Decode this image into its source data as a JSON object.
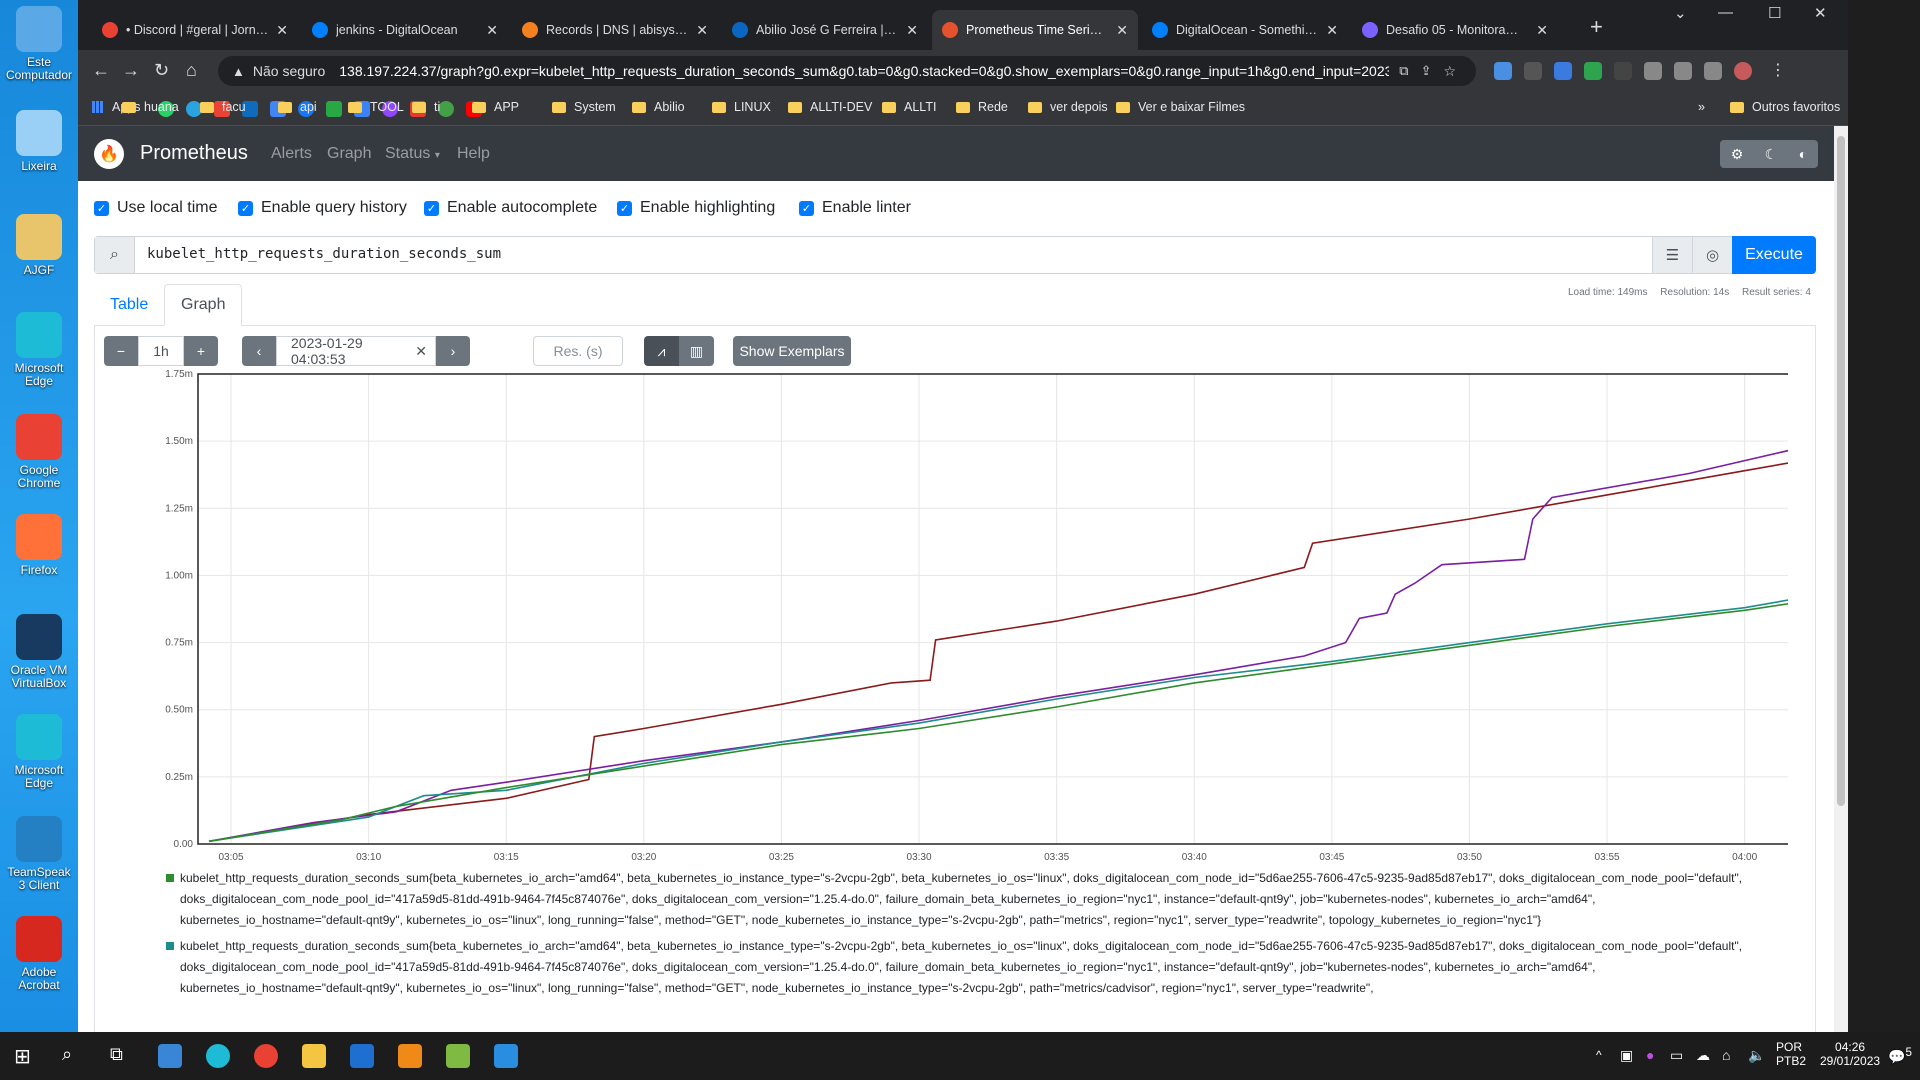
{
  "desktop": {
    "icons": [
      {
        "label": "Este Computador",
        "icon": "computer-icon",
        "color": "#5aa9e6"
      },
      {
        "label": "Lixeira",
        "icon": "recycle-bin-icon",
        "color": "#9ad0f5"
      },
      {
        "label": "AJGF",
        "icon": "user-folder-icon",
        "color": "#e8c46a"
      },
      {
        "label": "Microsoft Edge",
        "icon": "edge-icon",
        "color": "#1ebbd7"
      },
      {
        "label": "Google Chrome",
        "icon": "chrome-icon",
        "color": "#e94235"
      },
      {
        "label": "Firefox",
        "icon": "firefox-icon",
        "color": "#ff7139"
      },
      {
        "label": "Oracle VM VirtualBox",
        "icon": "virtualbox-icon",
        "color": "#183a61"
      },
      {
        "label": "Microsoft Edge",
        "icon": "edge-icon",
        "color": "#1ebbd7"
      },
      {
        "label": "TeamSpeak 3 Client",
        "icon": "teamspeak-icon",
        "color": "#2580c3"
      },
      {
        "label": "Adobe Acrobat",
        "icon": "acrobat-icon",
        "color": "#d7281f"
      }
    ]
  },
  "browser": {
    "tabs": [
      {
        "title": "• Discord | #geral | Jornada DevOps",
        "icon": "discord-icon",
        "color": "#e94235"
      },
      {
        "title": "jenkins - DigitalOcean",
        "icon": "digitalocean-icon",
        "color": "#0080ff"
      },
      {
        "title": "Records | DNS | abisystem.com",
        "icon": "cloudflare-icon",
        "color": "#f48120"
      },
      {
        "title": "Abilio José G Ferreira | LinkedIn",
        "icon": "linkedin-icon",
        "color": "#0a66c2"
      },
      {
        "title": "Prometheus Time Series Collection",
        "icon": "prometheus-icon",
        "color": "#e6522c",
        "active": true
      },
      {
        "title": "DigitalOcean - Something went wrong",
        "icon": "digitalocean-icon",
        "color": "#0080ff"
      },
      {
        "title": "Desafio 05 - Monitoramento",
        "icon": "notion-icon",
        "color": "#7b61ff"
      }
    ],
    "omnibox": {
      "security": "Não seguro",
      "url": "138.197.224.37/graph?g0.expr=kubelet_http_requests_duration_seconds_sum&g0.tab=0&g0.stacked=0&g0.show_exemplars=0&g0.range_input=1h&g0.end_input=2023-0..."
    },
    "bookmarks": {
      "apps_label": "Apps",
      "folders": [
        "huana",
        "facu",
        "api",
        "TOOL",
        "ti",
        "APP",
        "System",
        "Abilio",
        "LINUX",
        "ALLTI-DEV",
        "ALLTI",
        "Rede",
        "ver depois",
        "Ver e baixar Filmes"
      ],
      "other": "Outros favoritos"
    }
  },
  "prometheus": {
    "brand": "Prometheus",
    "nav": [
      "Alerts",
      "Graph",
      "Status",
      "Help"
    ],
    "options": [
      "Use local time",
      "Enable query history",
      "Enable autocomplete",
      "Enable highlighting",
      "Enable linter"
    ],
    "query": "kubelet_http_requests_duration_seconds_sum",
    "execute": "Execute",
    "stats": {
      "load_time": "Load time: 149ms",
      "resolution": "Resolution: 14s",
      "result_series": "Result series: 4"
    },
    "tabs": {
      "table": "Table",
      "graph": "Graph"
    },
    "controls": {
      "range": "1h",
      "end_time": "2023-01-29 04:03:53",
      "res_placeholder": "Res. (s)",
      "exemplars": "Show Exemplars"
    }
  },
  "chart_data": {
    "type": "line",
    "x_ticks": [
      "03:05",
      "03:10",
      "03:15",
      "03:20",
      "03:25",
      "03:30",
      "03:35",
      "03:40",
      "03:45",
      "03:50",
      "03:55",
      "04:00"
    ],
    "y_ticks": [
      "0.00",
      "0.25m",
      "0.50m",
      "0.75m",
      "1.00m",
      "1.25m",
      "1.50m",
      "1.75m"
    ],
    "ylim": [
      0,
      1.75
    ],
    "x_start_minute": 3.8,
    "x_end_minute": 63.9,
    "series": [
      {
        "color": "#8b1a1a",
        "points": [
          [
            4.2,
            0.01
          ],
          [
            10,
            0.11
          ],
          [
            15,
            0.17
          ],
          [
            18,
            0.24
          ],
          [
            18.2,
            0.4
          ],
          [
            20,
            0.43
          ],
          [
            25,
            0.52
          ],
          [
            29,
            0.6
          ],
          [
            30.4,
            0.61
          ],
          [
            30.6,
            0.76
          ],
          [
            35,
            0.83
          ],
          [
            40,
            0.93
          ],
          [
            44,
            1.03
          ],
          [
            44.3,
            1.12
          ],
          [
            50,
            1.21
          ],
          [
            55,
            1.3
          ],
          [
            60,
            1.39
          ],
          [
            63.9,
            1.46
          ]
        ]
      },
      {
        "color": "#7b1fa2",
        "points": [
          [
            4.2,
            0.01
          ],
          [
            8,
            0.08
          ],
          [
            11,
            0.12
          ],
          [
            13,
            0.2
          ],
          [
            15,
            0.23
          ],
          [
            20,
            0.31
          ],
          [
            25,
            0.38
          ],
          [
            30,
            0.46
          ],
          [
            35,
            0.55
          ],
          [
            40,
            0.63
          ],
          [
            44,
            0.7
          ],
          [
            45.5,
            0.75
          ],
          [
            46,
            0.84
          ],
          [
            47,
            0.86
          ],
          [
            47.3,
            0.93
          ],
          [
            48,
            0.97
          ],
          [
            49,
            1.04
          ],
          [
            52,
            1.06
          ],
          [
            52.3,
            1.21
          ],
          [
            53,
            1.29
          ],
          [
            58,
            1.38
          ],
          [
            63.9,
            1.52
          ]
        ]
      },
      {
        "color": "#1d8c8c",
        "points": [
          [
            4.2,
            0.01
          ],
          [
            10,
            0.1
          ],
          [
            12,
            0.18
          ],
          [
            15,
            0.2
          ],
          [
            20,
            0.3
          ],
          [
            25,
            0.38
          ],
          [
            30,
            0.45
          ],
          [
            35,
            0.54
          ],
          [
            40,
            0.62
          ],
          [
            45,
            0.68
          ],
          [
            50,
            0.75
          ],
          [
            55,
            0.82
          ],
          [
            60,
            0.88
          ],
          [
            63.9,
            0.95
          ]
        ]
      },
      {
        "color": "#2e8b2e",
        "points": [
          [
            4.2,
            0.01
          ],
          [
            9,
            0.09
          ],
          [
            11,
            0.14
          ],
          [
            15,
            0.21
          ],
          [
            20,
            0.29
          ],
          [
            25,
            0.37
          ],
          [
            30,
            0.43
          ],
          [
            35,
            0.51
          ],
          [
            40,
            0.6
          ],
          [
            45,
            0.67
          ],
          [
            50,
            0.74
          ],
          [
            55,
            0.81
          ],
          [
            60,
            0.87
          ],
          [
            63.9,
            0.93
          ]
        ]
      }
    ]
  },
  "legend": [
    {
      "color": "#2e8b2e",
      "text": "kubelet_http_requests_duration_seconds_sum{beta_kubernetes_io_arch=\"amd64\", beta_kubernetes_io_instance_type=\"s-2vcpu-2gb\", beta_kubernetes_io_os=\"linux\", doks_digitalocean_com_node_id=\"5d6ae255-7606-47c5-9235-9ad85d87eb17\", doks_digitalocean_com_node_pool=\"default\", doks_digitalocean_com_node_pool_id=\"417a59d5-81dd-491b-9464-7f45c874076e\", doks_digitalocean_com_version=\"1.25.4-do.0\", failure_domain_beta_kubernetes_io_region=\"nyc1\", instance=\"default-qnt9y\", job=\"kubernetes-nodes\", kubernetes_io_arch=\"amd64\", kubernetes_io_hostname=\"default-qnt9y\", kubernetes_io_os=\"linux\", long_running=\"false\", method=\"GET\", node_kubernetes_io_instance_type=\"s-2vcpu-2gb\", path=\"metrics\", region=\"nyc1\", server_type=\"readwrite\", topology_kubernetes_io_region=\"nyc1\"}"
    },
    {
      "color": "#1d8c8c",
      "text": "kubelet_http_requests_duration_seconds_sum{beta_kubernetes_io_arch=\"amd64\", beta_kubernetes_io_instance_type=\"s-2vcpu-2gb\", beta_kubernetes_io_os=\"linux\", doks_digitalocean_com_node_id=\"5d6ae255-7606-47c5-9235-9ad85d87eb17\", doks_digitalocean_com_node_pool=\"default\", doks_digitalocean_com_node_pool_id=\"417a59d5-81dd-491b-9464-7f45c874076e\", doks_digitalocean_com_version=\"1.25.4-do.0\", failure_domain_beta_kubernetes_io_region=\"nyc1\", instance=\"default-qnt9y\", job=\"kubernetes-nodes\", kubernetes_io_arch=\"amd64\", kubernetes_io_hostname=\"default-qnt9y\", kubernetes_io_os=\"linux\", long_running=\"false\", method=\"GET\", node_kubernetes_io_instance_type=\"s-2vcpu-2gb\", path=\"metrics/cadvisor\", region=\"nyc1\", server_type=\"readwrite\","
    }
  ],
  "taskbar": {
    "lang": "POR",
    "layout": "PTB2",
    "time": "04:26",
    "date": "29/01/2023",
    "notifications": "5"
  }
}
